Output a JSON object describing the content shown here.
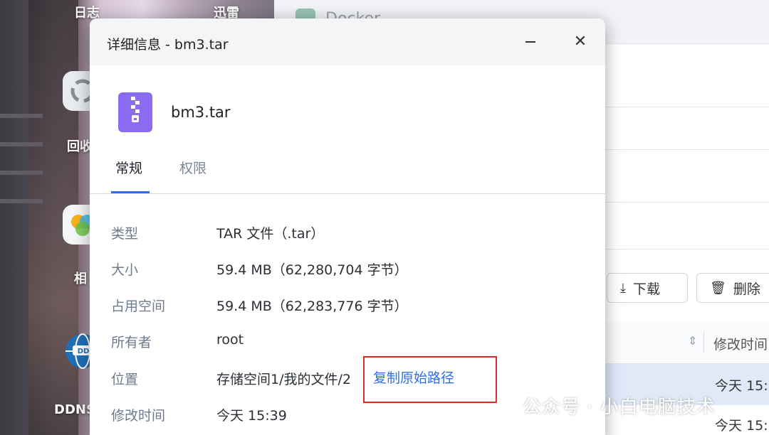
{
  "desktop": {
    "icons": [
      {
        "label": "日志"
      },
      {
        "label": "迅雷"
      },
      {
        "label": "回收"
      },
      {
        "label": "相"
      },
      {
        "label": "DDNS"
      }
    ]
  },
  "background_window": {
    "title": "Docker",
    "download_label": "下载",
    "delete_label": "删除",
    "column_modified": "修改时间",
    "row_values": [
      "今天 15:",
      "今天 15:"
    ]
  },
  "dialog": {
    "title": "详细信息 - bm3.tar",
    "file_name": "bm3.tar",
    "tabs": [
      {
        "label": "常规",
        "active": true
      },
      {
        "label": "权限",
        "active": false
      }
    ],
    "properties": [
      {
        "label": "类型",
        "value": "TAR 文件（.tar）"
      },
      {
        "label": "大小",
        "value": "59.4 MB（62,280,704 字节）"
      },
      {
        "label": "占用空间",
        "value": "59.4 MB（62,283,776 字节）"
      },
      {
        "label": "所有者",
        "value": "root"
      },
      {
        "label": "位置",
        "value": "存储空间1/我的文件/2"
      },
      {
        "label": "修改时间",
        "value": "今天 15:39"
      }
    ],
    "copy_path_label": "复制原始路径"
  },
  "watermark": {
    "text": "公众号 · 小白电脑技术"
  },
  "colors": {
    "accent": "#2f6fe0",
    "highlight_border": "#e02a2a",
    "file_icon": "#8b6cf0"
  }
}
